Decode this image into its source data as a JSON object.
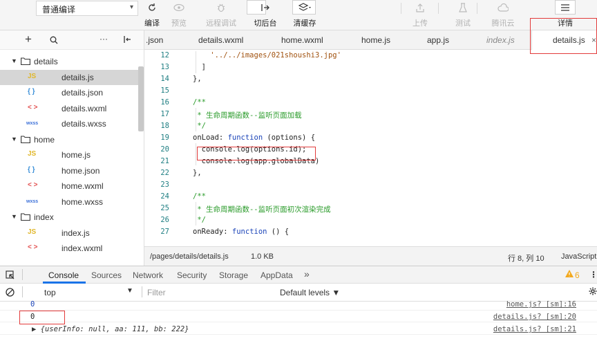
{
  "toolbar": {
    "compile_mode": "普通编译",
    "buttons": [
      {
        "label": "编译",
        "enabled": true
      },
      {
        "label": "预览",
        "enabled": false
      },
      {
        "label": "远程调试",
        "enabled": false
      },
      {
        "label": "切后台",
        "enabled": true
      },
      {
        "label": "清缓存",
        "enabled": true
      },
      {
        "label": "上传",
        "enabled": false
      },
      {
        "label": "测试",
        "enabled": false
      },
      {
        "label": "腾讯云",
        "enabled": false
      },
      {
        "label": "详情",
        "enabled": true
      }
    ]
  },
  "tree": {
    "items": [
      {
        "type": "folder",
        "label": "details"
      },
      {
        "type": "js",
        "badge": "JS",
        "label": "details.js",
        "selected": true
      },
      {
        "type": "json",
        "badge": "{ }",
        "label": "details.json"
      },
      {
        "type": "wxml",
        "badge": "< >",
        "label": "details.wxml"
      },
      {
        "type": "wxss",
        "badge": "wxss",
        "label": "details.wxss"
      },
      {
        "type": "folder",
        "label": "home"
      },
      {
        "type": "js",
        "badge": "JS",
        "label": "home.js"
      },
      {
        "type": "json",
        "badge": "{ }",
        "label": "home.json"
      },
      {
        "type": "wxml",
        "badge": "< >",
        "label": "home.wxml"
      },
      {
        "type": "wxss",
        "badge": "wxss",
        "label": "home.wxss"
      },
      {
        "type": "folder",
        "label": "index"
      },
      {
        "type": "js",
        "badge": "JS",
        "label": "index.js"
      },
      {
        "type": "wxml",
        "badge": "< >",
        "label": "index.wxml"
      }
    ]
  },
  "tabs": [
    {
      "label": ".json",
      "italic": false
    },
    {
      "label": "details.wxml",
      "italic": false
    },
    {
      "label": "home.wxml",
      "italic": false
    },
    {
      "label": "home.js",
      "italic": false
    },
    {
      "label": "app.js",
      "italic": false
    },
    {
      "label": "index.js",
      "italic": true
    },
    {
      "label": "details.js",
      "italic": false,
      "active": true
    }
  ],
  "code_lines": [
    {
      "n": "12",
      "text": "    '../../images/021shoushi3.jpg'"
    },
    {
      "n": "13",
      "text": "  ]"
    },
    {
      "n": "14",
      "text": "},"
    },
    {
      "n": "15",
      "text": ""
    },
    {
      "n": "16",
      "text": "/**"
    },
    {
      "n": "17",
      "text": " * 生命周期函数--监听页面加载"
    },
    {
      "n": "18",
      "text": " */"
    },
    {
      "n": "19",
      "text": "onLoad: function (options) {"
    },
    {
      "n": "20",
      "text": "  console.log(options.id);"
    },
    {
      "n": "21",
      "text": "  console.log(app.globalData)"
    },
    {
      "n": "22",
      "text": "},"
    },
    {
      "n": "23",
      "text": ""
    },
    {
      "n": "24",
      "text": "/**"
    },
    {
      "n": "25",
      "text": " * 生命周期函数--监听页面初次渲染完成"
    },
    {
      "n": "26",
      "text": " */"
    },
    {
      "n": "27",
      "text": "onReady: function () {"
    }
  ],
  "status": {
    "path": "/pages/details/details.js",
    "size": "1.0 KB",
    "cursor": "行 8, 列 10",
    "language": "JavaScript"
  },
  "devtools": {
    "tabs": [
      "Console",
      "Sources",
      "Network",
      "Security",
      "Storage",
      "AppData",
      "»"
    ],
    "warning_count": "6",
    "context": "top",
    "filter_placeholder": "Filter",
    "levels": "Default levels ▼",
    "console_rows": [
      {
        "value": "0",
        "source": "home.js? [sm]:16"
      },
      {
        "value": "0",
        "source": "details.js? [sm]:20"
      },
      {
        "value": "▶ {userInfo: null, aa: 111, bb: 222}",
        "source": "details.js? [sm]:21"
      }
    ]
  },
  "colors": {
    "highlight": "#e23a3a",
    "warning": "#f2a91e",
    "comment": "#2a9b2a",
    "keyword": "#1a43b8"
  }
}
